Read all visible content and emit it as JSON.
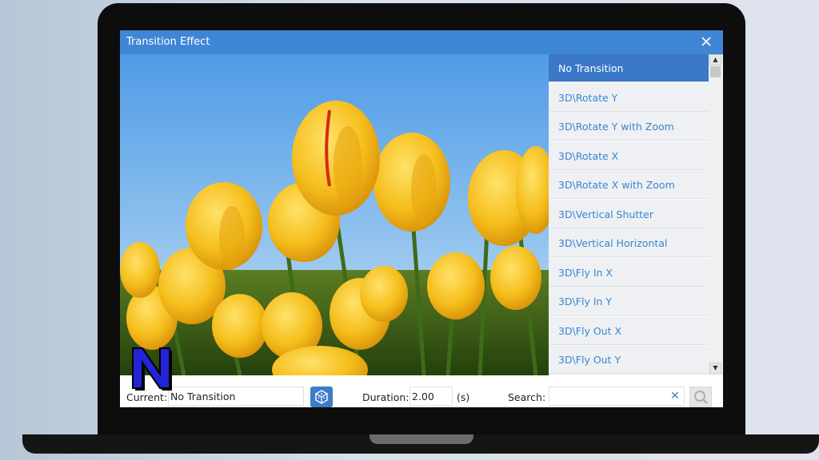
{
  "dialog": {
    "title": "Transition Effect"
  },
  "transitions": [
    "No Transition",
    "3D\\Rotate Y",
    "3D\\Rotate Y with Zoom",
    "3D\\Rotate X",
    "3D\\Rotate X with Zoom",
    "3D\\Vertical Shutter",
    "3D\\Vertical Horizontal",
    "3D\\Fly In X",
    "3D\\Fly In Y",
    "3D\\Fly Out X",
    "3D\\Fly Out Y"
  ],
  "selected_index": 0,
  "bottom": {
    "current_label": "Current:",
    "current_value": "No Transition",
    "duration_label": "Duration:",
    "duration_value": "2.00",
    "duration_unit": "(s)",
    "search_label": "Search:",
    "search_value": "",
    "clear_glyph": "✕"
  },
  "colors": {
    "accent": "#3f86d6",
    "selected": "#3b78c8",
    "link": "#3a86d0"
  },
  "icons": [
    "close-icon",
    "dice-icon",
    "search-icon",
    "scroll-up-icon",
    "scroll-down-icon"
  ]
}
